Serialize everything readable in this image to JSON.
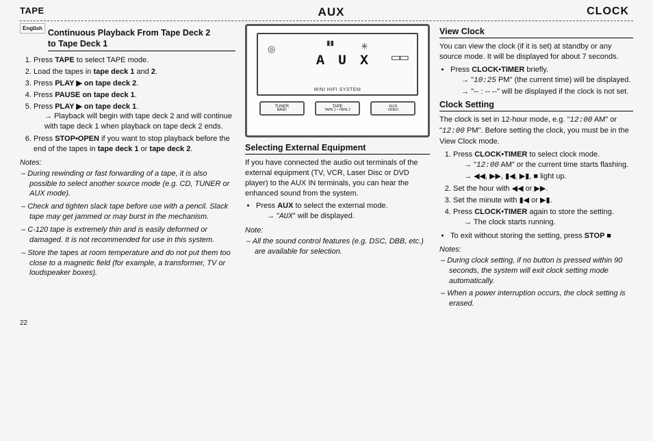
{
  "header": {
    "left": "TAPE",
    "mid": "AUX",
    "right": "CLOCK"
  },
  "tab": "English",
  "col1": {
    "title1": "Continuous Playback From Tape Deck 2",
    "title2": "to Tape Deck 1",
    "steps": {
      "s1a": "Press ",
      "s1b": "TAPE",
      "s1c": " to select TAPE mode.",
      "s2a": "Load the tapes in ",
      "s2b": "tape deck 1",
      "s2c": " and ",
      "s2d": "2",
      "s2e": ".",
      "s3a": "Press ",
      "s3b": "PLAY ▶ on tape deck 2",
      "s3c": ".",
      "s4a": "Press ",
      "s4b": "PAUSE on tape deck 1",
      "s4c": ".",
      "s5a": "Press ",
      "s5b": "PLAY ▶ on tape deck 1",
      "s5c": ".",
      "s5sub": "Playback will begin with tape deck 2 and will continue with tape deck 1 when playback on tape deck 2 ends.",
      "s6a": "Press ",
      "s6b": "STOP•OPEN",
      "s6c": " if you want to stop playback before the end of the tapes in ",
      "s6d": "tape deck 1",
      "s6e": " or ",
      "s6f": "tape deck 2",
      "s6g": "."
    },
    "notes_label": "Notes:",
    "notes": [
      "During rewinding or fast forwarding of a tape, it is also possible to select another source mode (e.g. CD, TUNER or AUX mode).",
      "Check and tighten slack tape before use with a pencil. Slack tape may get jammed or may burst in the mechanism.",
      "C-120 tape is extremely thin and is easily deformed or damaged. It is not recommended for use in this system.",
      "Store the tapes at room temperature and do not put them too close to a magnetic field (for example, a transformer, TV or loudspeaker boxes)."
    ]
  },
  "device": {
    "aux_text": "A U X",
    "mini": "MINI HIFI SYSTEM",
    "btn1a": "TUNER",
    "btn1b": "BAND",
    "btn2a": "TAPE",
    "btn2b": "TAPE 1 • TAPE 2",
    "btn3a": "AUX",
    "btn3b": "VIDEO"
  },
  "col2": {
    "title": "Selecting External Equipment",
    "p1": "If you have connected the audio out terminals of the external equipment (TV, VCR, Laser Disc or DVD player) to the AUX IN terminals, you can hear the enhanced sound from the system.",
    "b1a": "Press ",
    "b1b": "AUX",
    "b1c": " to select the external mode.",
    "b1sub_a": "\"",
    "b1sub_b": "AUX",
    "b1sub_c": "\" will be displayed.",
    "note_label": "Note:",
    "note1": "All the sound control features (e.g. DSC, DBB, etc.) are available for selection."
  },
  "col3a": {
    "title": "View Clock",
    "p1": "You can view the clock (if it is set) at standby or any source mode. It will be displayed for about 7 seconds.",
    "b1a": "Press ",
    "b1b": "CLOCK•TIMER",
    "b1c": " briefly.",
    "sub1a": "\"",
    "sub1b": "10:25",
    "sub1c": " PM\" (the current time) will be displayed.",
    "sub2": "\"-- : -- --\" will be displayed if the clock is not set."
  },
  "col3b": {
    "title": "Clock Setting",
    "p1a": "The clock is set in 12-hour mode, e.g. \"",
    "p1b": "12:00",
    "p1c": " AM\" or \"",
    "p1d": "12:00",
    "p1e": " PM\". Before setting the clock, you must be in the View Clock mode.",
    "s1a": "Press ",
    "s1b": "CLOCK•TIMER",
    "s1c": " to select clock mode.",
    "s1sub_a": "\"",
    "s1sub_b": "12:00",
    "s1sub_c": " AM\" or the current time starts flashing.",
    "s1sub2": "◀◀, ▶▶, ▮◀, ▶▮, ■ light up.",
    "s2": "Set the hour with ◀◀ or ▶▶.",
    "s3": "Set the minute with ▮◀ or ▶▮.",
    "s4a": "Press ",
    "s4b": "CLOCK•TIMER",
    "s4c": " again to store the setting.",
    "s4sub": "The clock starts running.",
    "b_exit_a": "To exit without storing the setting, press ",
    "b_exit_b": "STOP ■",
    "notes_label": "Notes:",
    "n1": "During clock setting, if no button is pressed within 90 seconds, the system will exit clock setting mode automatically.",
    "n2": "When a power interruption occurs, the clock setting is erased."
  },
  "page_number": "22"
}
